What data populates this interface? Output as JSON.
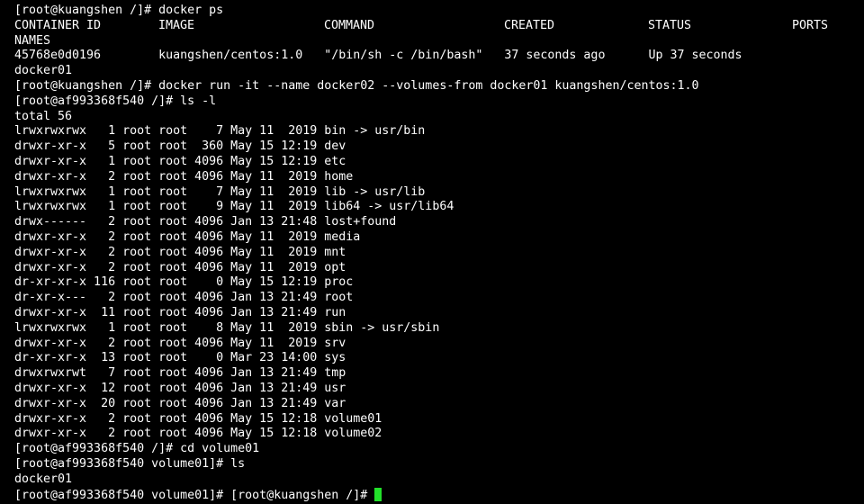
{
  "terminal": {
    "lines": [
      "[root@kuangshen /]# docker ps",
      "__HEADER__",
      "NAMES",
      "45768e0d0196        kuangshen/centos:1.0   \"/bin/sh -c /bin/bash\"   37 seconds ago      Up 37 seconds",
      "docker01",
      "[root@kuangshen /]# docker run -it --name docker02 --volumes-from docker01 kuangshen/centos:1.0",
      "[root@af993368f540 /]# ls -l",
      "total 56",
      "lrwxrwxrwx   1 root root    7 May 11  2019 bin -> usr/bin",
      "drwxr-xr-x   5 root root  360 May 15 12:19 dev",
      "drwxr-xr-x   1 root root 4096 May 15 12:19 etc",
      "drwxr-xr-x   2 root root 4096 May 11  2019 home",
      "lrwxrwxrwx   1 root root    7 May 11  2019 lib -> usr/lib",
      "lrwxrwxrwx   1 root root    9 May 11  2019 lib64 -> usr/lib64",
      "drwx------   2 root root 4096 Jan 13 21:48 lost+found",
      "drwxr-xr-x   2 root root 4096 May 11  2019 media",
      "drwxr-xr-x   2 root root 4096 May 11  2019 mnt",
      "drwxr-xr-x   2 root root 4096 May 11  2019 opt",
      "dr-xr-xr-x 116 root root    0 May 15 12:19 proc",
      "dr-xr-x---   2 root root 4096 Jan 13 21:49 root",
      "drwxr-xr-x  11 root root 4096 Jan 13 21:49 run",
      "lrwxrwxrwx   1 root root    8 May 11  2019 sbin -> usr/sbin",
      "drwxr-xr-x   2 root root 4096 May 11  2019 srv",
      "dr-xr-xr-x  13 root root    0 Mar 23 14:00 sys",
      "drwxrwxrwt   7 root root 4096 Jan 13 21:49 tmp",
      "drwxr-xr-x  12 root root 4096 Jan 13 21:49 usr",
      "drwxr-xr-x  20 root root 4096 Jan 13 21:49 var",
      "drwxr-xr-x   2 root root 4096 May 15 12:18 volume01",
      "drwxr-xr-x   2 root root 4096 May 15 12:18 volume02",
      "[root@af993368f540 /]# cd volume01",
      "[root@af993368f540 volume01]# ls",
      "docker01",
      "[root@af993368f540 volume01]# [root@kuangshen /]# "
    ],
    "header": {
      "container_id": "CONTAINER ID",
      "image": "IMAGE",
      "command": "COMMAND",
      "created": "CREATED",
      "status": "STATUS",
      "ports": "PORTS"
    },
    "cursor_color": "#22e02a"
  }
}
